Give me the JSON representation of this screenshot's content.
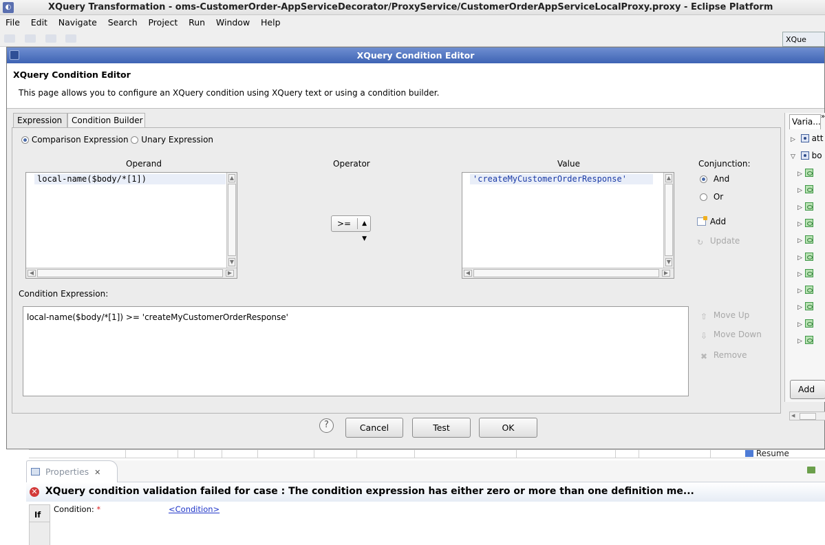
{
  "window": {
    "title": "XQuery Transformation - oms-CustomerOrder-AppServiceDecorator/ProxyService/CustomerOrderAppServiceLocalProxy.proxy - Eclipse Platform",
    "menu": [
      "File",
      "Edit",
      "Navigate",
      "Search",
      "Project",
      "Run",
      "Window",
      "Help"
    ],
    "editor_tab": "XQue"
  },
  "dialog": {
    "title": "XQuery Condition Editor",
    "banner_heading": "XQuery Condition Editor",
    "banner_description": "This page allows you to configure an XQuery condition using XQuery text or using a condition builder.",
    "tabs": [
      {
        "label": "Expression",
        "active": false
      },
      {
        "label": "Condition Builder",
        "active": true
      }
    ],
    "expression_type": {
      "options": [
        "Comparison Expression",
        "Unary Expression"
      ],
      "selected": "Comparison Expression"
    },
    "operand": {
      "header": "Operand",
      "value": "local-name($body/*[1])"
    },
    "operator": {
      "header": "Operator",
      "selected": ">="
    },
    "value": {
      "header": "Value",
      "value": "'createMyCustomerOrderResponse'"
    },
    "conjunction": {
      "header": "Conjunction:",
      "options": [
        "And",
        "Or"
      ],
      "selected": "And"
    },
    "actions": {
      "add": "Add",
      "update": "Update",
      "move_up": "Move Up",
      "move_down": "Move Down",
      "remove": "Remove"
    },
    "condition_expression": {
      "label": "Condition Expression:",
      "value": "local-name($body/*[1]) >= 'createMyCustomerOrderResponse'"
    },
    "buttons": {
      "help": "?",
      "cancel": "Cancel",
      "test": "Test",
      "ok": "OK"
    }
  },
  "variables_panel": {
    "tab_label": "Varia...",
    "tab_overflow": "»",
    "tree": [
      {
        "label": "att",
        "expanded": false,
        "kind": "variable"
      },
      {
        "label": "bo",
        "expanded": true,
        "kind": "variable"
      }
    ],
    "child_count": 11,
    "add_label": "Add"
  },
  "background": {
    "resume_label": "Resume"
  },
  "properties": {
    "tab_label": "Properties",
    "tab_close": "✕",
    "error_message": "XQuery condition validation failed for case : The condition expression has either zero or more than one definition me...",
    "side_tab": "If",
    "condition_label": "Condition:",
    "required_marker": "*",
    "condition_link": "<Condition>"
  }
}
